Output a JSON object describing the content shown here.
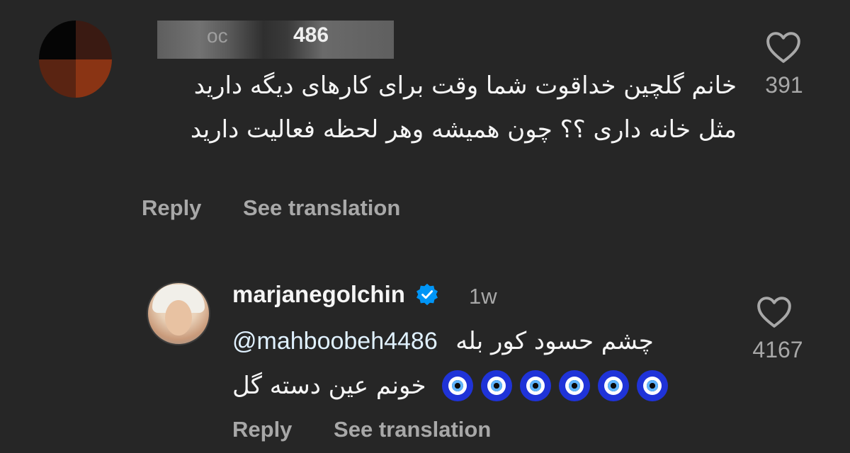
{
  "comment": {
    "username_visible": "486",
    "username_faint": "oc",
    "text": "خانم گلچین خداقوت شما وقت برای کارهای دیگه دارید مثل خانه داری ؟؟ چون همیشه وهر لحظه فعالیت دارید",
    "like_count": "391",
    "reply_label": "Reply",
    "translate_label": "See translation"
  },
  "reply": {
    "username": "marjanegolchin",
    "time": "1w",
    "mention": "@mahboobeh4486",
    "text_line1": "چشم حسود کور بله",
    "text_line2": "خونم عین دسته گل",
    "emoji_count": 6,
    "emoji_name": "nazar-amulet",
    "like_count": "4167",
    "reply_label": "Reply",
    "translate_label": "See translation"
  },
  "colors": {
    "background": "#262626",
    "text": "#f5f5f5",
    "secondary": "#a8a8a8",
    "verified": "#0095f6"
  }
}
